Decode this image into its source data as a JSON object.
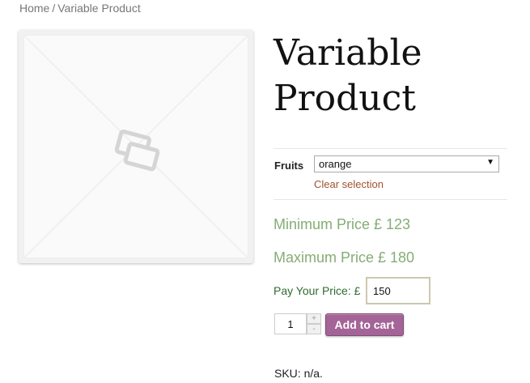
{
  "breadcrumb": {
    "home": "Home",
    "separator": "/",
    "current": "Variable Product"
  },
  "product": {
    "image_icon": "placeholder-image-icon",
    "title": "Variable Product",
    "variation": {
      "label": "Fruits",
      "selected": "orange",
      "clear_label": "Clear selection"
    },
    "min_price": "Minimum Price £ 123",
    "max_price": "Maximum Price £ 180",
    "pay_label": "Pay Your Price: £",
    "pay_value": "150",
    "quantity": "1",
    "qty_plus": "+",
    "qty_minus": "-",
    "add_to_cart": "Add to cart",
    "sku": "SKU: n/a."
  },
  "colors": {
    "button": "#a46497",
    "price": "#85ad74",
    "pay_label": "#2f6b2f",
    "link": "#a0522d"
  }
}
